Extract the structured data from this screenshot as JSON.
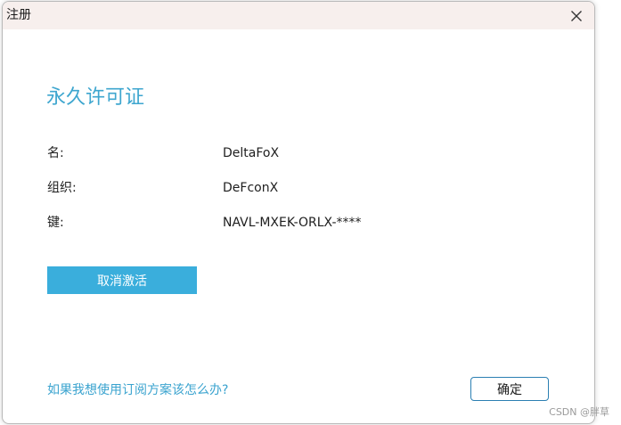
{
  "window": {
    "title": "注册"
  },
  "license": {
    "heading": "永久许可证",
    "fields": [
      {
        "label": "名:",
        "value": "DeltaFoX"
      },
      {
        "label": "组织:",
        "value": "DeFconX"
      },
      {
        "label": "键:",
        "value": "NAVL-MXEK-ORLX-****"
      }
    ]
  },
  "actions": {
    "deactivate_label": "取消激活",
    "subscription_link": "如果我想使用订阅方案该怎么办?",
    "ok_label": "确定"
  },
  "watermark": {
    "text": "CSDN @胖草"
  },
  "colors": {
    "accent": "#3aaedc",
    "heading": "#3ea6cf",
    "titlebar": "#f7efed"
  }
}
